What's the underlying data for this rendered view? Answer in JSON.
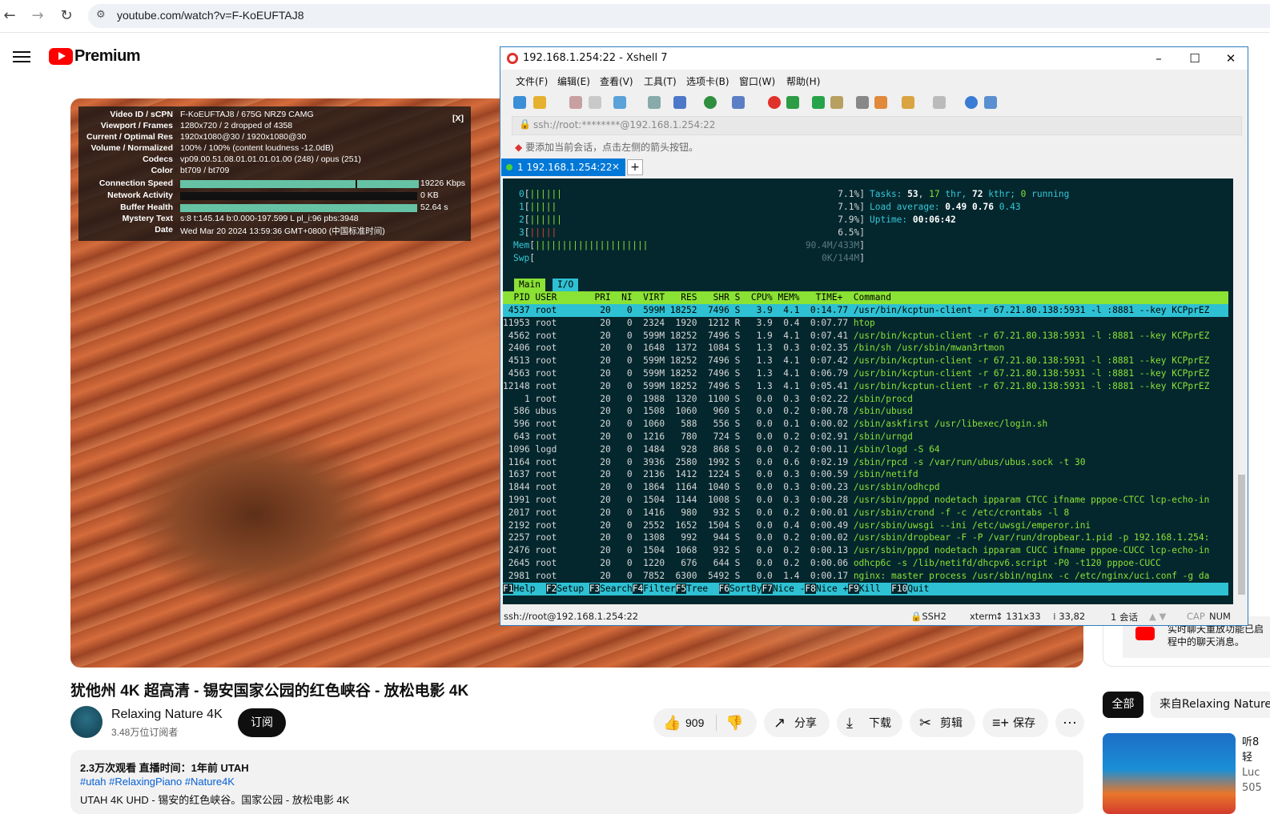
{
  "browser": {
    "url": "youtube.com/watch?v=F-KoEUFTAJ8",
    "back_icon": "←",
    "forward_icon": "→",
    "reload_icon": "↻"
  },
  "youtube": {
    "logo_text": "Premium",
    "video": {
      "title": "犹他州 4K 超高清 - 锡安国家公园的红色峡谷 - 放松电影 4K",
      "stats_close": "[X]",
      "stats": [
        {
          "label": "Video ID / sCPN",
          "value": "F-KoEUFTAJ8  /  675G NRZ9 CAMG"
        },
        {
          "label": "Viewport / Frames",
          "value": "1280x720 / 2 dropped of 4358"
        },
        {
          "label": "Current / Optimal Res",
          "value": "1920x1080@30 / 1920x1080@30"
        },
        {
          "label": "Volume / Normalized",
          "value": "100% / 100% (content loudness -12.0dB)"
        },
        {
          "label": "Codecs",
          "value": "vp09.00.51.08.01.01.01.01.00 (248) / opus (251)"
        },
        {
          "label": "Color",
          "value": "bt709 / bt709"
        },
        {
          "label": "Connection Speed",
          "value": "19226 Kbps"
        },
        {
          "label": "Network Activity",
          "value": "0 KB"
        },
        {
          "label": "Buffer Health",
          "value": "52.64 s"
        },
        {
          "label": "Mystery Text",
          "value": "s:8 t:145.14 b:0.000-197.599 L pl_i:96 pbs:3948"
        },
        {
          "label": "Date",
          "value": "Wed Mar 20 2024 13:59:36 GMT+0800 (中国标准时间)"
        }
      ]
    },
    "channel": {
      "name": "Relaxing Nature 4K",
      "subscribers": "3.48万位订阅者",
      "subscribe_label": "订阅"
    },
    "actions": {
      "likes": "909",
      "share": "分享",
      "download": "下载",
      "clip": "剪辑",
      "save": "保存",
      "more": "⋯"
    },
    "description": {
      "line1": "2.3万次观看  直播时间：1年前  UTAH",
      "hashtags": "#utah #RelaxingPiano #Nature4K",
      "line3": "UTAH 4K UHD - 锡安的红色峡谷。国家公园 - 放松电影 4K"
    },
    "sidebar": {
      "live_line1": "实时聊天重放功能已启",
      "live_line2": "程中的聊天消息。",
      "chip_all": "全部",
      "chip_from": "来自Relaxing Nature",
      "rec_lines": [
        "听8",
        "轻 ",
        "Luc",
        "505"
      ]
    }
  },
  "xshell": {
    "title": "192.168.1.254:22 - Xshell 7",
    "menu": [
      "文件(F)",
      "编辑(E)",
      "查看(V)",
      "工具(T)",
      "选项卡(B)",
      "窗口(W)",
      "帮助(H)"
    ],
    "address": "ssh://root:********@192.168.1.254:22",
    "hint": "要添加当前会话，点击左侧的箭头按钮。",
    "tab_label": "1 192.168.1.254:22",
    "tab_close": "×",
    "tab_add": "+",
    "status": {
      "conn": "ssh://root@192.168.1.254:22",
      "proto": "SSH2",
      "term": "xterm",
      "size": "131x33",
      "cursor": "33,82",
      "sessions": "1 会话",
      "cap": "CAP",
      "num": "NUM"
    },
    "htop": {
      "cpu": [
        {
          "id": "0",
          "bars": "||||||",
          "pct": "7.1%"
        },
        {
          "id": "1",
          "bars": "|||||",
          "pct": "7.1%"
        },
        {
          "id": "2",
          "bars": "||||||",
          "pct": "7.9%"
        },
        {
          "id": "3",
          "bars": "|||||",
          "pct": "6.5%"
        }
      ],
      "mem": {
        "label": "Mem",
        "bars": "|||||||||||||||||||||",
        "value": "90.4M/433M"
      },
      "swp": {
        "label": "Swp",
        "value": "0K/144M"
      },
      "tasks": {
        "prefix": "Tasks: ",
        "count": "53",
        "thr": "17",
        "thr_label": " thr, ",
        "kthr": "72",
        "kthr_label": " kthr; ",
        "running": "0",
        "running_label": " running"
      },
      "load": {
        "prefix": "Load average: ",
        "l1": "0.49",
        "l5": "0.76",
        "l15": "0.43"
      },
      "uptime": {
        "prefix": "Uptime: ",
        "value": "00:06:42"
      },
      "tab_main": "Main",
      "tab_io": "I/O",
      "header": "  PID USER       PRI  NI  VIRT   RES   SHR S  CPU% MEM%   TIME+  Command",
      "rows": [
        {
          "pid": "4537",
          "user": "root",
          "pri": "20",
          "ni": "0",
          "virt": "599M",
          "res": "18252",
          "shr": "7496",
          "s": "S",
          "cpu": "3.9",
          "mem": "4.1",
          "time": "0:14.77",
          "cmd": "/usr/bin/kcptun-client -r 67.21.80.138:5931 -l :8881 --key KCPprEZ"
        },
        {
          "pid": "11953",
          "user": "root",
          "pri": "20",
          "ni": "0",
          "virt": "2324",
          "res": "1920",
          "shr": "1212",
          "s": "R",
          "cpu": "3.9",
          "mem": "0.4",
          "time": "0:07.77",
          "cmd": "htop"
        },
        {
          "pid": "4562",
          "user": "root",
          "pri": "20",
          "ni": "0",
          "virt": "599M",
          "res": "18252",
          "shr": "7496",
          "s": "S",
          "cpu": "1.9",
          "mem": "4.1",
          "time": "0:07.41",
          "cmd": "/usr/bin/kcptun-client -r 67.21.80.138:5931 -l :8881 --key KCPprEZ"
        },
        {
          "pid": "2406",
          "user": "root",
          "pri": "20",
          "ni": "0",
          "virt": "1648",
          "res": "1372",
          "shr": "1084",
          "s": "S",
          "cpu": "1.3",
          "mem": "0.3",
          "time": "0:02.35",
          "cmd": "/bin/sh /usr/sbin/mwan3rtmon"
        },
        {
          "pid": "4513",
          "user": "root",
          "pri": "20",
          "ni": "0",
          "virt": "599M",
          "res": "18252",
          "shr": "7496",
          "s": "S",
          "cpu": "1.3",
          "mem": "4.1",
          "time": "0:07.42",
          "cmd": "/usr/bin/kcptun-client -r 67.21.80.138:5931 -l :8881 --key KCPprEZ"
        },
        {
          "pid": "4563",
          "user": "root",
          "pri": "20",
          "ni": "0",
          "virt": "599M",
          "res": "18252",
          "shr": "7496",
          "s": "S",
          "cpu": "1.3",
          "mem": "4.1",
          "time": "0:06.79",
          "cmd": "/usr/bin/kcptun-client -r 67.21.80.138:5931 -l :8881 --key KCPprEZ"
        },
        {
          "pid": "12148",
          "user": "root",
          "pri": "20",
          "ni": "0",
          "virt": "599M",
          "res": "18252",
          "shr": "7496",
          "s": "S",
          "cpu": "1.3",
          "mem": "4.1",
          "time": "0:05.41",
          "cmd": "/usr/bin/kcptun-client -r 67.21.80.138:5931 -l :8881 --key KCPprEZ"
        },
        {
          "pid": "1",
          "user": "root",
          "pri": "20",
          "ni": "0",
          "virt": "1988",
          "res": "1320",
          "shr": "1100",
          "s": "S",
          "cpu": "0.0",
          "mem": "0.3",
          "time": "0:02.22",
          "cmd": "/sbin/procd"
        },
        {
          "pid": "586",
          "user": "ubus",
          "pri": "20",
          "ni": "0",
          "virt": "1508",
          "res": "1060",
          "shr": "960",
          "s": "S",
          "cpu": "0.0",
          "mem": "0.2",
          "time": "0:00.78",
          "cmd": "/sbin/ubusd"
        },
        {
          "pid": "596",
          "user": "root",
          "pri": "20",
          "ni": "0",
          "virt": "1060",
          "res": "588",
          "shr": "556",
          "s": "S",
          "cpu": "0.0",
          "mem": "0.1",
          "time": "0:00.02",
          "cmd": "/sbin/askfirst /usr/libexec/login.sh"
        },
        {
          "pid": "643",
          "user": "root",
          "pri": "20",
          "ni": "0",
          "virt": "1216",
          "res": "780",
          "shr": "724",
          "s": "S",
          "cpu": "0.0",
          "mem": "0.2",
          "time": "0:02.91",
          "cmd": "/sbin/urngd"
        },
        {
          "pid": "1096",
          "user": "logd",
          "pri": "20",
          "ni": "0",
          "virt": "1484",
          "res": "928",
          "shr": "868",
          "s": "S",
          "cpu": "0.0",
          "mem": "0.2",
          "time": "0:00.11",
          "cmd": "/sbin/logd -S 64"
        },
        {
          "pid": "1164",
          "user": "root",
          "pri": "20",
          "ni": "0",
          "virt": "3936",
          "res": "2580",
          "shr": "1992",
          "s": "S",
          "cpu": "0.0",
          "mem": "0.6",
          "time": "0:02.19",
          "cmd": "/sbin/rpcd -s /var/run/ubus/ubus.sock -t 30"
        },
        {
          "pid": "1637",
          "user": "root",
          "pri": "20",
          "ni": "0",
          "virt": "2136",
          "res": "1412",
          "shr": "1224",
          "s": "S",
          "cpu": "0.0",
          "mem": "0.3",
          "time": "0:00.59",
          "cmd": "/sbin/netifd"
        },
        {
          "pid": "1844",
          "user": "root",
          "pri": "20",
          "ni": "0",
          "virt": "1864",
          "res": "1164",
          "shr": "1040",
          "s": "S",
          "cpu": "0.0",
          "mem": "0.3",
          "time": "0:00.23",
          "cmd": "/usr/sbin/odhcpd"
        },
        {
          "pid": "1991",
          "user": "root",
          "pri": "20",
          "ni": "0",
          "virt": "1504",
          "res": "1144",
          "shr": "1008",
          "s": "S",
          "cpu": "0.0",
          "mem": "0.3",
          "time": "0:00.28",
          "cmd": "/usr/sbin/pppd nodetach ipparam CTCC ifname pppoe-CTCC lcp-echo-in"
        },
        {
          "pid": "2017",
          "user": "root",
          "pri": "20",
          "ni": "0",
          "virt": "1416",
          "res": "980",
          "shr": "932",
          "s": "S",
          "cpu": "0.0",
          "mem": "0.2",
          "time": "0:00.01",
          "cmd": "/usr/sbin/crond -f -c /etc/crontabs -l 8"
        },
        {
          "pid": "2192",
          "user": "root",
          "pri": "20",
          "ni": "0",
          "virt": "2552",
          "res": "1652",
          "shr": "1504",
          "s": "S",
          "cpu": "0.0",
          "mem": "0.4",
          "time": "0:00.49",
          "cmd": "/usr/sbin/uwsgi --ini /etc/uwsgi/emperor.ini"
        },
        {
          "pid": "2257",
          "user": "root",
          "pri": "20",
          "ni": "0",
          "virt": "1308",
          "res": "992",
          "shr": "944",
          "s": "S",
          "cpu": "0.0",
          "mem": "0.2",
          "time": "0:00.02",
          "cmd": "/usr/sbin/dropbear -F -P /var/run/dropbear.1.pid -p 192.168.1.254:"
        },
        {
          "pid": "2476",
          "user": "root",
          "pri": "20",
          "ni": "0",
          "virt": "1504",
          "res": "1068",
          "shr": "932",
          "s": "S",
          "cpu": "0.0",
          "mem": "0.2",
          "time": "0:00.13",
          "cmd": "/usr/sbin/pppd nodetach ipparam CUCC ifname pppoe-CUCC lcp-echo-in"
        },
        {
          "pid": "2645",
          "user": "root",
          "pri": "20",
          "ni": "0",
          "virt": "1220",
          "res": "676",
          "shr": "644",
          "s": "S",
          "cpu": "0.0",
          "mem": "0.2",
          "time": "0:00.06",
          "cmd": "odhcp6c -s /lib/netifd/dhcpv6.script -P0 -t120 pppoe-CUCC"
        },
        {
          "pid": "2981",
          "user": "root",
          "pri": "20",
          "ni": "0",
          "virt": "7852",
          "res": "6300",
          "shr": "5492",
          "s": "S",
          "cpu": "0.0",
          "mem": "1.4",
          "time": "0:00.17",
          "cmd": "nginx: master process /usr/sbin/nginx -c /etc/nginx/uci.conf -g da"
        }
      ],
      "fkeys": [
        {
          "k": "F1",
          "l": "Help  "
        },
        {
          "k": "F2",
          "l": "Setup "
        },
        {
          "k": "F3",
          "l": "Search"
        },
        {
          "k": "F4",
          "l": "Filter"
        },
        {
          "k": "F5",
          "l": "Tree  "
        },
        {
          "k": "F6",
          "l": "SortBy"
        },
        {
          "k": "F7",
          "l": "Nice -"
        },
        {
          "k": "F8",
          "l": "Nice +"
        },
        {
          "k": "F9",
          "l": "Kill  "
        },
        {
          "k": "F10",
          "l": "Quit"
        }
      ]
    }
  }
}
